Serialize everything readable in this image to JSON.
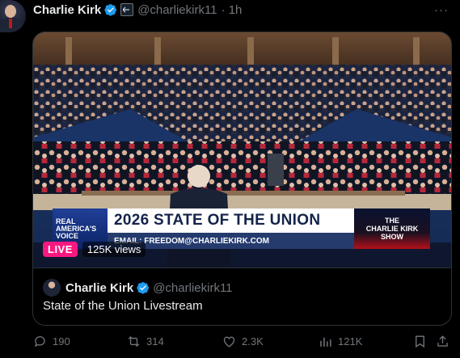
{
  "post": {
    "author_name": "Charlie Kirk",
    "handle": "@charliekirk11",
    "time": "· 1h",
    "more": "···"
  },
  "media": {
    "brand_line1": "REAL",
    "brand_line2": "AMERICA'S",
    "brand_line3": "VOICE",
    "title": "2026 STATE OF THE UNION",
    "subtitle": "EMAIL: FREEDOM@CHARLIEKIRK.COM",
    "show_line1": "THE",
    "show_line2": "CHARLIE KIRK",
    "show_line3": "SHOW",
    "live_label": "LIVE",
    "views": "125K views"
  },
  "quote": {
    "author_name": "Charlie Kirk",
    "handle": "@charliekirk11",
    "text": "State of the Union Livestream"
  },
  "actions": {
    "replies": "190",
    "reposts": "314",
    "likes": "2.3K",
    "views": "121K"
  },
  "colors": {
    "accent_live": "#f91880",
    "verified": "#1d9bf0",
    "muted": "#71767b"
  }
}
